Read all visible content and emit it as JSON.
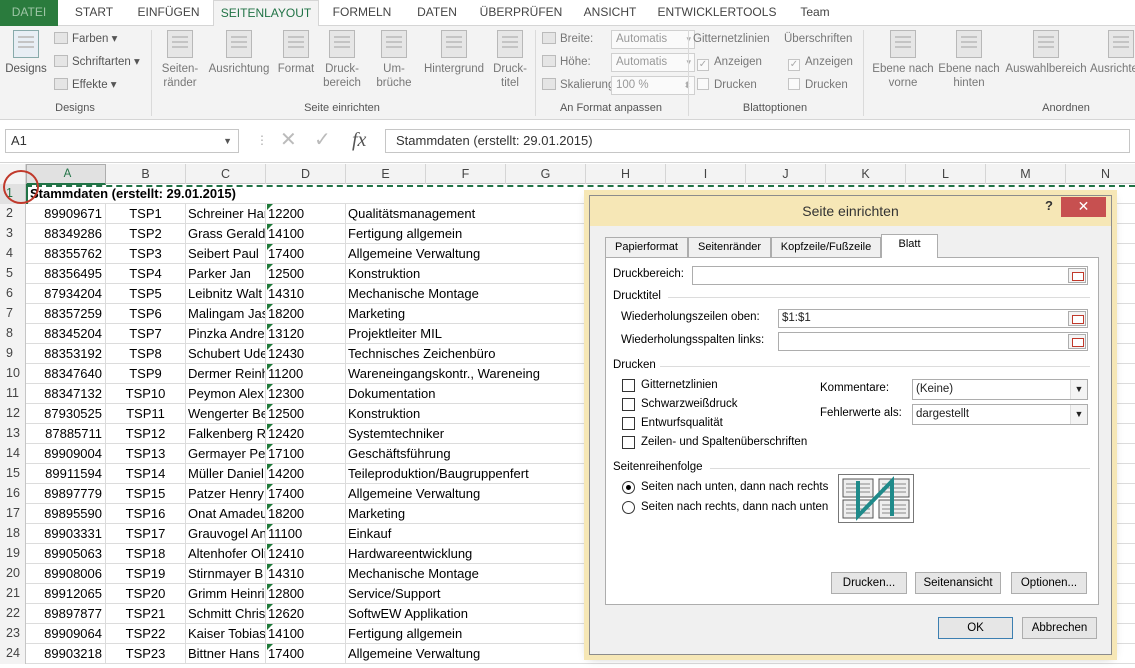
{
  "ribbon_tabs": [
    {
      "label": "DATEI"
    },
    {
      "label": "START"
    },
    {
      "label": "EINFÜGEN"
    },
    {
      "label": "SEITENLAYOUT"
    },
    {
      "label": "FORMELN"
    },
    {
      "label": "DATEN"
    },
    {
      "label": "ÜBERPRÜFEN"
    },
    {
      "label": "ANSICHT"
    },
    {
      "label": "ENTWICKLERTOOLS"
    },
    {
      "label": "Team"
    }
  ],
  "ribbon": {
    "designs": {
      "label": "Designs",
      "group": "Designs",
      "farben": "Farben",
      "schriftarten": "Schriftarten",
      "effekte": "Effekte"
    },
    "seite": {
      "group": "Seite einrichten",
      "buttons": [
        {
          "label": "Seiten-\nränder"
        },
        {
          "label": "Ausrichtung"
        },
        {
          "label": "Format"
        },
        {
          "label": "Druck-\nbereich"
        },
        {
          "label": "Um-\nbrüche"
        },
        {
          "label": "Hintergrund"
        },
        {
          "label": "Druck-\ntitel"
        }
      ]
    },
    "anpassen": {
      "group": "An Format anpassen",
      "breite": "Breite:",
      "hoehe": "Höhe:",
      "skalierung": "Skalierung:",
      "breite_val": "Automatis",
      "hoehe_val": "Automatis",
      "skal_val": "100 %"
    },
    "blatt": {
      "group": "Blattoptionen",
      "gitter": "Gitternetzlinien",
      "ueber": "Überschriften",
      "anzeigen1": "Anzeigen",
      "anzeigen2": "Anzeigen",
      "drucken1": "Drucken",
      "drucken2": "Drucken"
    },
    "anordnen": {
      "group": "Anordnen",
      "eine_vorne": "Ebene nach\nvorne",
      "eine_hinten": "Ebene nach\nhinten",
      "auswahl": "Auswahlbereich",
      "ausrichten": "Ausrichten"
    }
  },
  "formula_bar": {
    "name_box": "A1",
    "formula": "Stammdaten (erstellt: 29.01.2015)"
  },
  "columns": [
    "A",
    "B",
    "C",
    "D",
    "E",
    "F",
    "G",
    "H",
    "I",
    "J",
    "K",
    "L",
    "M",
    "N"
  ],
  "title_cell": "Stammdaten (erstellt: 29.01.2015)",
  "rows": [
    {
      "n": "2",
      "a": "89909671",
      "b": "TSP1",
      "c": "Schreiner Har",
      "d": "12200",
      "e": "Qualitätsmanagement"
    },
    {
      "n": "3",
      "a": "88349286",
      "b": "TSP2",
      "c": "Grass Gerald",
      "d": "14100",
      "e": "Fertigung allgemein"
    },
    {
      "n": "4",
      "a": "88355762",
      "b": "TSP3",
      "c": "Seibert Paul",
      "d": "17400",
      "e": "Allgemeine Verwaltung"
    },
    {
      "n": "5",
      "a": "88356495",
      "b": "TSP4",
      "c": "Parker Jan",
      "d": "12500",
      "e": "Konstruktion"
    },
    {
      "n": "6",
      "a": "87934204",
      "b": "TSP5",
      "c": "Leibnitz Walt",
      "d": "14310",
      "e": "Mechanische Montage"
    },
    {
      "n": "7",
      "a": "88357259",
      "b": "TSP6",
      "c": "Malingam Jas",
      "d": "18200",
      "e": "Marketing"
    },
    {
      "n": "8",
      "a": "88345204",
      "b": "TSP7",
      "c": "Pinzka Andre",
      "d": "13120",
      "e": "Projektleiter MIL"
    },
    {
      "n": "9",
      "a": "88353192",
      "b": "TSP8",
      "c": "Schubert Ude",
      "d": "12430",
      "e": "Technisches Zeichenbüro"
    },
    {
      "n": "10",
      "a": "88347640",
      "b": "TSP9",
      "c": "Dermer Reinh",
      "d": "11200",
      "e": "Wareneingangskontr., Wareneing"
    },
    {
      "n": "11",
      "a": "88347132",
      "b": "TSP10",
      "c": "Peymon Alex",
      "d": "12300",
      "e": "Dokumentation"
    },
    {
      "n": "12",
      "a": "87930525",
      "b": "TSP11",
      "c": "Wengerter Be",
      "d": "12500",
      "e": "Konstruktion"
    },
    {
      "n": "13",
      "a": "87885711",
      "b": "TSP12",
      "c": "Falkenberg R",
      "d": "12420",
      "e": "Systemtechniker"
    },
    {
      "n": "14",
      "a": "89909004",
      "b": "TSP13",
      "c": "Germayer Pe",
      "d": "17100",
      "e": "Geschäftsführung"
    },
    {
      "n": "15",
      "a": "89911594",
      "b": "TSP14",
      "c": "Müller Daniel",
      "d": "14200",
      "e": "Teileproduktion/Baugruppenfert"
    },
    {
      "n": "16",
      "a": "89897779",
      "b": "TSP15",
      "c": "Patzer Henry",
      "d": "17400",
      "e": "Allgemeine Verwaltung"
    },
    {
      "n": "17",
      "a": "89895590",
      "b": "TSP16",
      "c": "Onat Amadeu",
      "d": "18200",
      "e": "Marketing"
    },
    {
      "n": "18",
      "a": "89903331",
      "b": "TSP17",
      "c": "Grauvogel An",
      "d": "11100",
      "e": "Einkauf"
    },
    {
      "n": "19",
      "a": "89905063",
      "b": "TSP18",
      "c": "Altenhofer Oli",
      "d": "12410",
      "e": "Hardwareentwicklung"
    },
    {
      "n": "20",
      "a": "89908006",
      "b": "TSP19",
      "c": "Stirnmayer B",
      "d": "14310",
      "e": "Mechanische Montage"
    },
    {
      "n": "21",
      "a": "89912065",
      "b": "TSP20",
      "c": "Grimm Heinri",
      "d": "12800",
      "e": "Service/Support"
    },
    {
      "n": "22",
      "a": "89897877",
      "b": "TSP21",
      "c": "Schmitt Chris",
      "d": "12620",
      "e": "SoftwEW Applikation"
    },
    {
      "n": "23",
      "a": "89909064",
      "b": "TSP22",
      "c": "Kaiser Tobias",
      "d": "14100",
      "e": "Fertigung allgemein"
    },
    {
      "n": "24",
      "a": "89903218",
      "b": "TSP23",
      "c": "Bittner Hans",
      "d": "17400",
      "e": "Allgemeine Verwaltung"
    }
  ],
  "dialog": {
    "title": "Seite einrichten",
    "help": "?",
    "close": "✕",
    "tabs": [
      {
        "label": "Papierformat"
      },
      {
        "label": "Seitenränder"
      },
      {
        "label": "Kopfzeile/Fußzeile"
      },
      {
        "label": "Blatt"
      }
    ],
    "druckbereich_label": "Druckbereich:",
    "druckbereich_value": "",
    "drucktitel_label": "Drucktitel",
    "wdh_zeilen_label": "Wiederholungszeilen oben:",
    "wdh_zeilen_value": "$1:$1",
    "wdh_spalten_label": "Wiederholungsspalten links:",
    "wdh_spalten_value": "",
    "drucken_label": "Drucken",
    "checks": [
      {
        "label": "Gitternetzlinien"
      },
      {
        "label": "Schwarzweißdruck"
      },
      {
        "label": "Entwurfsqualität"
      },
      {
        "label": "Zeilen- und Spaltenüberschriften"
      }
    ],
    "kommentare_label": "Kommentare:",
    "kommentare_value": "(Keine)",
    "fehlerwerte_label": "Fehlerwerte als:",
    "fehlerwerte_value": "dargestellt",
    "reihenfolge_label": "Seitenreihenfolge",
    "radio1": "Seiten nach unten, dann nach rechts",
    "radio2": "Seiten nach rechts, dann nach unten",
    "btn_drucken": "Drucken...",
    "btn_seitenansicht": "Seitenansicht",
    "btn_optionen": "Optionen...",
    "btn_ok": "OK",
    "btn_abbrechen": "Abbrechen"
  }
}
